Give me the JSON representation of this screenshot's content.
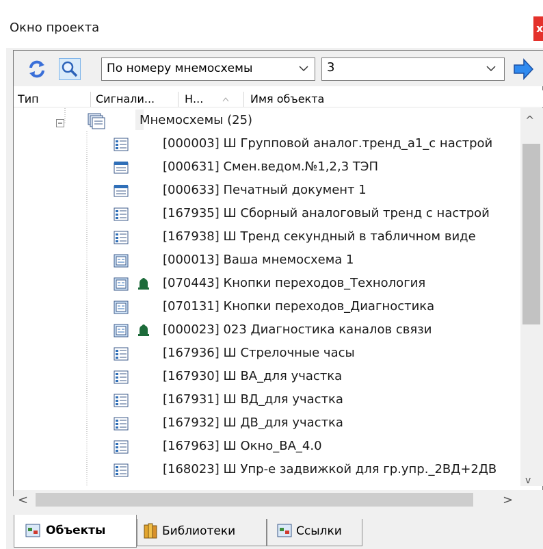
{
  "window": {
    "title": "Окно проекта",
    "close_label": "x"
  },
  "toolbar": {
    "refresh_icon": "refresh-icon",
    "search_icon": "search-icon",
    "mode_select_value": "По номеру мнемосхемы",
    "value_select_value": "3",
    "go_icon": "arrow-right-icon"
  },
  "columns": [
    "Тип",
    "Сигнали...",
    "Н...",
    "Имя объекта"
  ],
  "tree": {
    "root_label": "Мнемосхемы (25)",
    "items": [
      {
        "label": "[000003] Ш Групповой аналог.тренд_а1_с настрой",
        "icon": "trend-icon",
        "alarm": false
      },
      {
        "label": "[000631] Смен.ведом.№1,2,3  ТЭП",
        "icon": "document-icon",
        "alarm": false
      },
      {
        "label": "[000633] Печатный документ 1",
        "icon": "document-icon",
        "alarm": false
      },
      {
        "label": "[167935] Ш Сборный аналоговый тренд с настрой",
        "icon": "trend-icon",
        "alarm": false
      },
      {
        "label": "[167938] Ш Тренд секундный в табличном виде",
        "icon": "trend-icon",
        "alarm": false
      },
      {
        "label": "[000013] Ваша мнемосхема 1",
        "icon": "mnemo-icon",
        "alarm": false
      },
      {
        "label": "[070443] Кнопки переходов_Технология",
        "icon": "mnemo-icon",
        "alarm": true
      },
      {
        "label": "[070131] Кнопки переходов_Диагностика",
        "icon": "mnemo-icon",
        "alarm": false
      },
      {
        "label": "[000023] 023 Диагностика каналов связи",
        "icon": "mnemo-icon",
        "alarm": true
      },
      {
        "label": "[167936] Ш Стрелочные часы",
        "icon": "trend-icon",
        "alarm": false
      },
      {
        "label": "[167930] Ш ВА_для участка",
        "icon": "trend-icon",
        "alarm": false
      },
      {
        "label": "[167931] Ш ВД_для участка",
        "icon": "trend-icon",
        "alarm": false
      },
      {
        "label": "[167932] Ш ДВ_для участка",
        "icon": "trend-icon",
        "alarm": false
      },
      {
        "label": "[167963] Ш Окно_ВА_4.0",
        "icon": "trend-icon",
        "alarm": false
      },
      {
        "label": "[168023] Ш Упр-е задвижкой для гр.упр._2ВД+2ДВ",
        "icon": "trend-icon",
        "alarm": false
      }
    ]
  },
  "scroll": {
    "left": "<",
    "right": ">",
    "up": "^",
    "down": "v"
  },
  "tabs": [
    {
      "label": "Объекты",
      "active": true
    },
    {
      "label": "Библиотеки",
      "active": false
    },
    {
      "label": "Ссылки",
      "active": false
    }
  ],
  "colors": {
    "close_bg": "#e4312b",
    "accent_blue": "#1f6fd1",
    "alarm_green": "#1d6b3a"
  }
}
